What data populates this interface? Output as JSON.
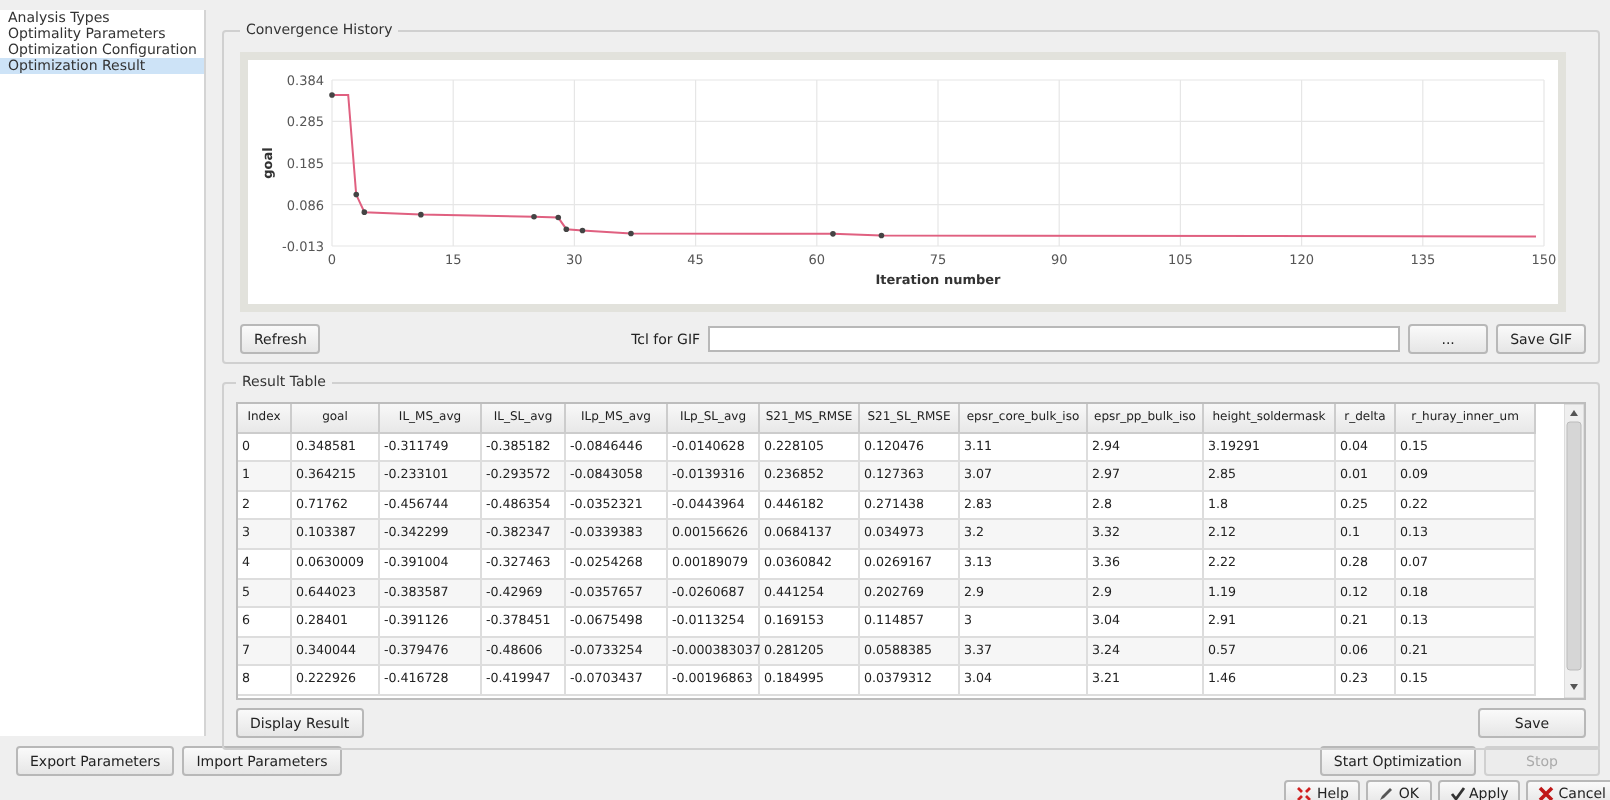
{
  "sidebar": {
    "items": [
      {
        "label": "Analysis Types",
        "selected": false
      },
      {
        "label": "Optimality Parameters",
        "selected": false
      },
      {
        "label": "Optimization Configuration",
        "selected": false
      },
      {
        "label": "Optimization Result",
        "selected": true
      }
    ]
  },
  "convergence_history": {
    "title": "Convergence History",
    "chart_data": {
      "type": "line",
      "xlabel": "Iteration number",
      "ylabel": "goal",
      "xlim": [
        0,
        150
      ],
      "ylim": [
        -0.013,
        0.384
      ],
      "xticks": [
        0,
        15,
        30,
        45,
        60,
        75,
        90,
        105,
        120,
        135,
        150
      ],
      "yticks": [
        {
          "value": 0.384,
          "label": "0.384"
        },
        {
          "value": 0.285,
          "label": "0.285"
        },
        {
          "value": 0.185,
          "label": "0.185"
        },
        {
          "value": 0.086,
          "label": "0.086"
        },
        {
          "value": -0.013,
          "label": "-0.013"
        }
      ],
      "x": [
        0,
        2,
        3,
        4,
        11,
        25,
        28,
        29,
        31,
        37,
        62,
        68,
        149
      ],
      "grid": true,
      "series": [
        {
          "color": "#e06080",
          "values": [
            0.348,
            0.348,
            0.11,
            0.068,
            0.062,
            0.057,
            0.055,
            0.027,
            0.024,
            0.017,
            0.016,
            0.012,
            0.01
          ]
        }
      ]
    },
    "refresh_button": "Refresh",
    "tcl_label": "Tcl for GIF",
    "browse_button": "...",
    "save_gif_button": "Save GIF"
  },
  "result_table": {
    "title": "Result Table",
    "columns": [
      "Index",
      "goal",
      "IL_MS_avg",
      "IL_SL_avg",
      "ILp_MS_avg",
      "ILp_SL_avg",
      "S21_MS_RMSE",
      "S21_SL_RMSE",
      "epsr_core_bulk_iso",
      "epsr_pp_bulk_iso",
      "height_soldermask",
      "r_delta",
      "r_huray_inner_um"
    ],
    "rows": [
      [
        "0",
        "0.348581",
        "-0.311749",
        "-0.385182",
        "-0.0846446",
        "-0.0140628",
        "0.228105",
        "0.120476",
        "3.11",
        "2.94",
        "3.19291",
        "0.04",
        "0.15"
      ],
      [
        "1",
        "0.364215",
        "-0.233101",
        "-0.293572",
        "-0.0843058",
        "-0.0139316",
        "0.236852",
        "0.127363",
        "3.07",
        "2.97",
        "2.85",
        "0.01",
        "0.09"
      ],
      [
        "2",
        "0.71762",
        "-0.456744",
        "-0.486354",
        "-0.0352321",
        "-0.0443964",
        "0.446182",
        "0.271438",
        "2.83",
        "2.8",
        "1.8",
        "0.25",
        "0.22"
      ],
      [
        "3",
        "0.103387",
        "-0.342299",
        "-0.382347",
        "-0.0339383",
        "0.00156626",
        "0.0684137",
        "0.034973",
        "3.2",
        "3.32",
        "2.12",
        "0.1",
        "0.13"
      ],
      [
        "4",
        "0.0630009",
        "-0.391004",
        "-0.327463",
        "-0.0254268",
        "0.00189079",
        "0.0360842",
        "0.0269167",
        "3.13",
        "3.36",
        "2.22",
        "0.28",
        "0.07"
      ],
      [
        "5",
        "0.644023",
        "-0.383587",
        "-0.42969",
        "-0.0357657",
        "-0.0260687",
        "0.441254",
        "0.202769",
        "2.9",
        "2.9",
        "1.19",
        "0.12",
        "0.18"
      ],
      [
        "6",
        "0.28401",
        "-0.391126",
        "-0.378451",
        "-0.0675498",
        "-0.0113254",
        "0.169153",
        "0.114857",
        "3",
        "3.04",
        "2.91",
        "0.21",
        "0.13"
      ],
      [
        "7",
        "0.340044",
        "-0.379476",
        "-0.48606",
        "-0.0733254",
        "-0.000383037",
        "0.281205",
        "0.0588385",
        "3.37",
        "3.24",
        "0.57",
        "0.06",
        "0.21"
      ],
      [
        "8",
        "0.222926",
        "-0.416728",
        "-0.419947",
        "-0.0703437",
        "-0.00196863",
        "0.184995",
        "0.0379312",
        "3.04",
        "3.21",
        "1.46",
        "0.23",
        "0.15"
      ]
    ],
    "display_button": "Display Result",
    "save_button": "Save"
  },
  "footer": {
    "left_buttons": [
      "Export Parameters",
      "Import Parameters"
    ],
    "start_button": {
      "label": "Start Optimization",
      "disabled": false
    },
    "stop_button": {
      "label": "Stop",
      "disabled": true
    },
    "dialog_buttons": [
      {
        "kind": "help",
        "label": "Help"
      },
      {
        "kind": "ok",
        "label": "OK"
      },
      {
        "kind": "apply",
        "label": "Apply"
      },
      {
        "kind": "cancel",
        "label": "Cancel"
      }
    ]
  }
}
